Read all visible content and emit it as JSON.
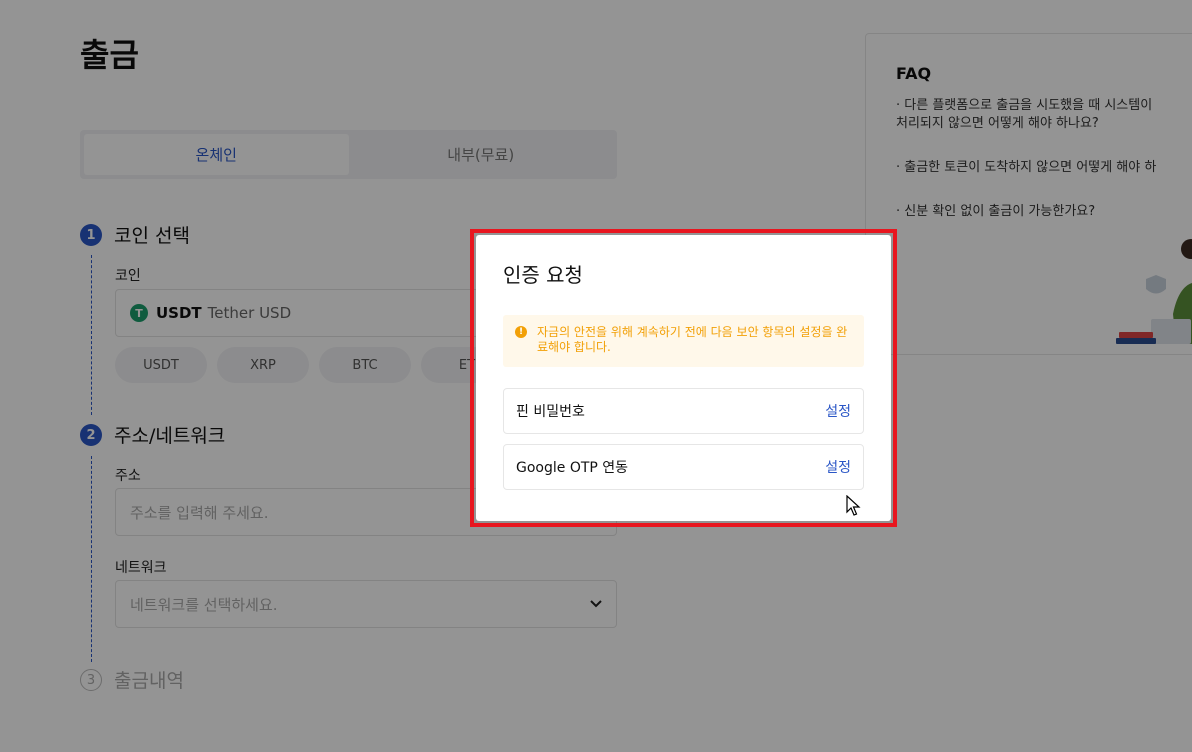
{
  "page": {
    "title": "출금",
    "tabs": [
      {
        "label": "온체인",
        "active": true
      },
      {
        "label": "내부(무료)",
        "active": false
      }
    ],
    "steps": [
      {
        "number": "1",
        "title": "코인 선택"
      },
      {
        "number": "2",
        "title": "주소/네트워크"
      },
      {
        "number": "3",
        "title": "출금내역"
      }
    ],
    "coin": {
      "label": "코인",
      "selected_symbol": "USDT",
      "selected_name": "Tether USD",
      "icon_letter": "T",
      "quick_chips": [
        "USDT",
        "XRP",
        "BTC",
        "ET"
      ]
    },
    "address": {
      "label": "주소",
      "placeholder": "주소를 입력해 주세요."
    },
    "network": {
      "label": "네트워크",
      "placeholder": "네트워크를 선택하세요.",
      "chevron": "⌄"
    }
  },
  "faq": {
    "title": "FAQ",
    "items": [
      "· 다른 플랫폼으로 출금을 시도했을 때 시스템이\n  처리되지 않으면 어떻게 해야 하나요?",
      "· 출금한 토큰이 도착하지 않으면 어떻게 해야 하",
      "· 신분 확인 없이 출금이 가능한가요?"
    ]
  },
  "modal": {
    "title": "인증 요청",
    "warning": "자금의 안전을 위해 계속하기 전에 다음 보안 항목의 설정을 완료해야 합니다.",
    "warning_icon": "!",
    "items": [
      {
        "label": "핀 비밀번호",
        "action": "설정"
      },
      {
        "label": "Google OTP 연동",
        "action": "설정"
      }
    ]
  },
  "colors": {
    "accent": "#2a56c6",
    "warning": "#f2a007",
    "highlight": "#e8161f",
    "coin": "#1a9d6c"
  }
}
